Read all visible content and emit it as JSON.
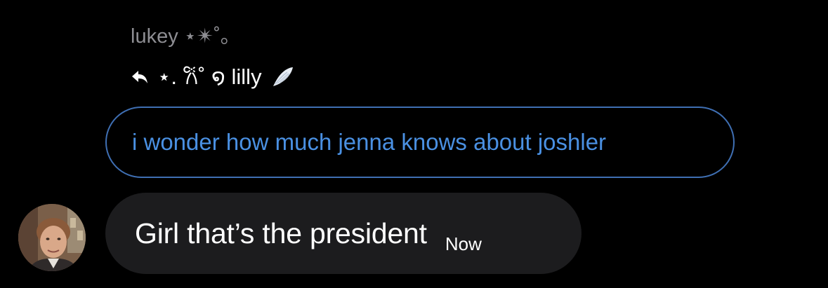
{
  "conversation": {
    "sender_name": "lukey ⋆✴︎˚｡",
    "reply": {
      "to_name": "⋆. 𐙚˚ ໑ lilly",
      "icon": "reply-arrow-icon",
      "trailing_icon": "wing-icon"
    },
    "quoted_message": {
      "text": "i wonder how much jenna knows about joshler"
    },
    "message": {
      "text": "Girl that’s the president",
      "timestamp": "Now"
    },
    "avatar": {
      "icon": "avatar"
    }
  },
  "colors": {
    "background": "#000000",
    "sender_name": "#8e8e93",
    "quote_border": "#3f6fb3",
    "quote_text": "#4a90e2",
    "message_bubble": "#1c1c1e",
    "text": "#ffffff"
  }
}
